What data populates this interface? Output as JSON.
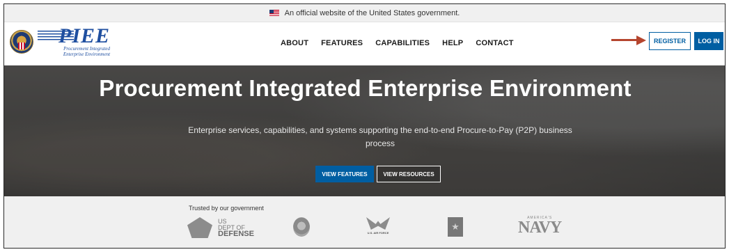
{
  "gov_banner": {
    "text": "An official website of the United States government."
  },
  "header": {
    "logo": {
      "word": "PIEE",
      "sub_line1": "Procurement Integrated",
      "sub_line2": "Enterprise Environment"
    },
    "nav": [
      {
        "label": "ABOUT"
      },
      {
        "label": "FEATURES"
      },
      {
        "label": "CAPABILITIES"
      },
      {
        "label": "HELP"
      },
      {
        "label": "CONTACT"
      }
    ],
    "register_label": "REGISTER",
    "login_label": "LOG IN",
    "arrow_color": "#b5452e",
    "accent": "#005ea2"
  },
  "hero": {
    "title": "Procurement Integrated Enterprise Environment",
    "subtitle": "Enterprise services, capabilities, and systems supporting the end-to-end Procure-to-Pay (P2P) business process",
    "primary_button": "VIEW FEATURES",
    "secondary_button": "VIEW RESOURCES"
  },
  "trusted": {
    "label": "Trusted by our government",
    "logos": {
      "dod_line1": "US",
      "dod_line2": "DEPT OF",
      "dod_line3": "DEFENSE",
      "airforce": "U.S. AIR FORCE",
      "army": "U.S. ARMY",
      "navy_top": "AMERICA'S",
      "navy": "NAVY"
    }
  }
}
